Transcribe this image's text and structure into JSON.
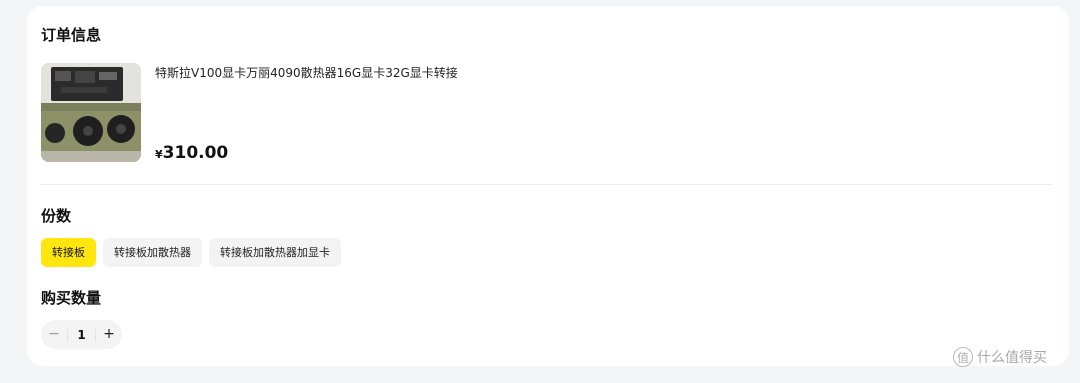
{
  "order_section": {
    "title": "订单信息",
    "product": {
      "name": "特斯拉V100显卡万丽4090散热器16G显卡32G显卡转接",
      "currency": "¥",
      "price": "310.00",
      "image": "graphics-card-photo"
    }
  },
  "spec_section": {
    "title": "份数",
    "options": [
      {
        "label": "转接板",
        "selected": true
      },
      {
        "label": "转接板加散热器",
        "selected": false
      },
      {
        "label": "转接板加散热器加显卡",
        "selected": false
      }
    ]
  },
  "quantity_section": {
    "title": "购买数量",
    "minus": "−",
    "value": "1",
    "plus": "+"
  },
  "watermark": {
    "icon": "值",
    "text": "什么值得买"
  },
  "colors": {
    "accent": "#ffe60f",
    "background": "#f4f5f7",
    "card": "#ffffff"
  }
}
